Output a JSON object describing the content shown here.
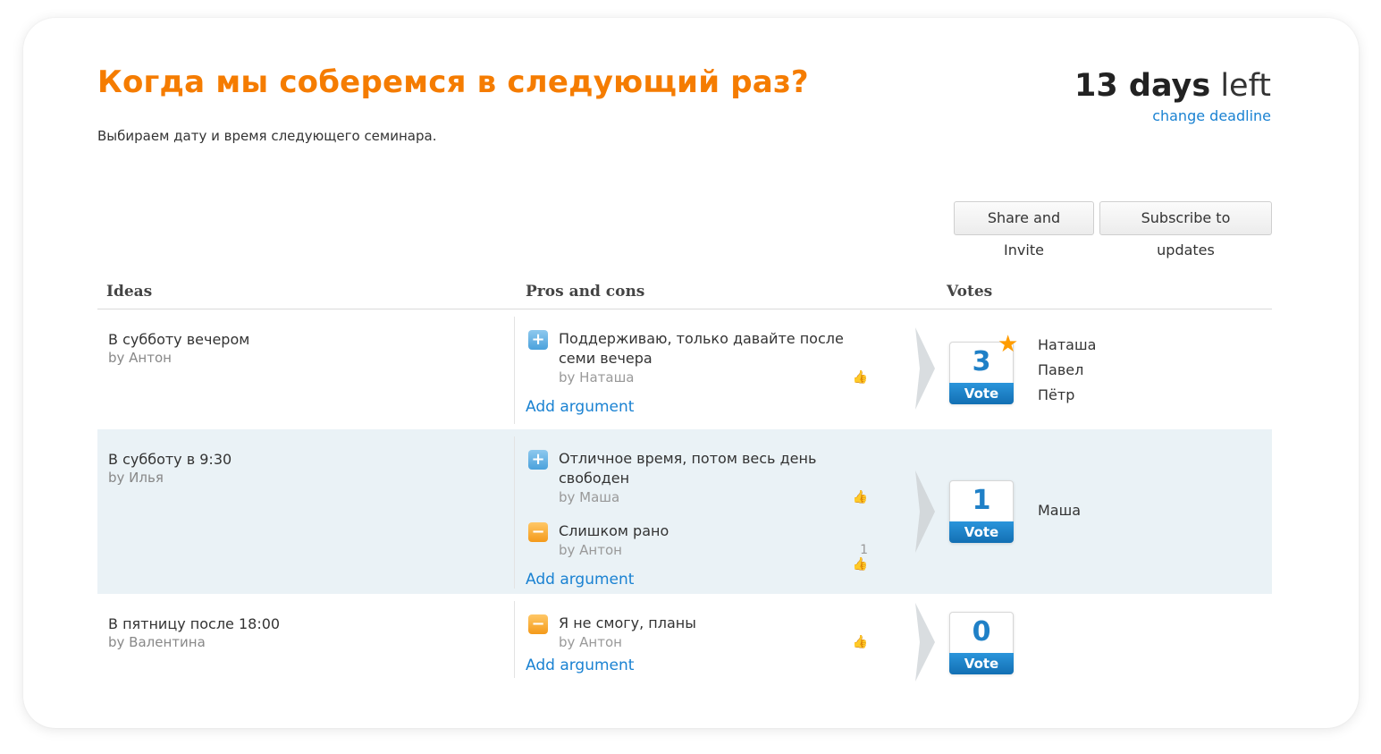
{
  "header": {
    "title": "Когда мы соберемся в следующий раз?",
    "subtitle": "Выбираем дату и время следующего семинара.",
    "days_count": "13 days",
    "days_suffix": "left",
    "change_deadline": "change deadline"
  },
  "actions": {
    "share": "Share and Invite",
    "subscribe": "Subscribe to updates"
  },
  "table": {
    "col_ideas": "Ideas",
    "col_pros": "Pros and cons",
    "col_votes": "Votes"
  },
  "add_argument": "Add argument",
  "vote_label": "Vote",
  "colors": {
    "accent": "#f57c00",
    "link": "#1a82d2",
    "vote": "#1f80c7",
    "star": "#ff9c00"
  },
  "icons": {
    "pro": "plus-icon",
    "con": "minus-icon",
    "like": "thumbs-up-icon",
    "star": "star-icon",
    "arrow": "chevron-right-icon"
  },
  "ideas": [
    {
      "title": "В субботу вечером",
      "author": "by Антон",
      "votes": "3",
      "voters": [
        "Наташа",
        "Павел",
        "Пётр"
      ],
      "args": [
        {
          "type": "pro",
          "text_line1": "Поддерживаю, только давайте после",
          "text_line2": "семи вечера",
          "author": "by Наташа",
          "likes": ""
        }
      ]
    },
    {
      "title": "В субботу в 9:30",
      "author": "by Илья",
      "votes": "1",
      "voters": [
        "Маша"
      ],
      "args": [
        {
          "type": "pro",
          "text_line1": "Отличное время, потом весь день",
          "text_line2": "свободен",
          "author": "by Маша",
          "likes": ""
        },
        {
          "type": "con",
          "text_line1": "Слишком рано",
          "author": "by Антон",
          "likes": "1"
        }
      ]
    },
    {
      "title": "В пятницу после 18:00",
      "author": "by Валентина",
      "votes": "0",
      "voters": [],
      "args": [
        {
          "type": "con",
          "text_line1": "Я не смогу, планы",
          "author": "by Антон",
          "likes": ""
        }
      ]
    }
  ]
}
